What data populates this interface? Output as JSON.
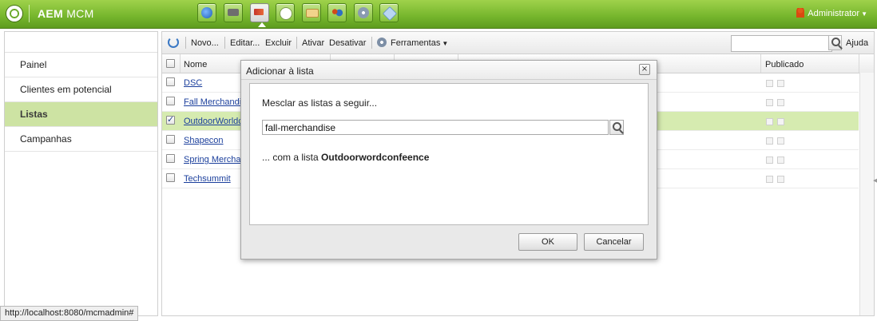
{
  "app": {
    "title_bold": "AEM",
    "title_rest": " MCM",
    "user": "Administrator",
    "top_icons": [
      "globe-icon",
      "camera-icon",
      "megaphone-icon",
      "chat-icon",
      "mail-icon",
      "people-icon",
      "gears-icon",
      "tag-icon"
    ],
    "active_icon_index": 2,
    "accent": "#75b52c"
  },
  "sidebar": {
    "items": [
      {
        "label": "Painel"
      },
      {
        "label": "Clientes em potencial"
      },
      {
        "label": "Listas"
      },
      {
        "label": "Campanhas"
      }
    ],
    "selected_index": 2
  },
  "toolbar": {
    "novo": "Novo...",
    "editar": "Editar...",
    "excluir": "Excluir",
    "ativar": "Ativar",
    "desativar": "Desativar",
    "ferramentas": "Ferramentas",
    "search_value": "",
    "help": "Ajuda"
  },
  "grid": {
    "columns": {
      "name": "Nome",
      "published": "Publicado"
    },
    "rows": [
      {
        "name": "DSC",
        "checked": false
      },
      {
        "name": "Fall Merchandis",
        "checked": false
      },
      {
        "name": "OutdoorWorldc",
        "checked": true
      },
      {
        "name": "Shapecon",
        "checked": false
      },
      {
        "name": "Spring Merchan",
        "checked": false
      },
      {
        "name": "Techsummit",
        "checked": false
      }
    ],
    "selected_row_index": 2
  },
  "status_bar": {
    "text": "http://localhost:8080/mcmadmin#"
  },
  "dialog": {
    "title": "Adicionar à lista",
    "close": "×",
    "prompt": "Mesclar as listas a seguir...",
    "input_value": "fall-merchandise",
    "info_prefix": "... com a lista ",
    "info_list": "Outdoorwordconfeence",
    "ok": "OK",
    "cancel": "Cancelar"
  }
}
